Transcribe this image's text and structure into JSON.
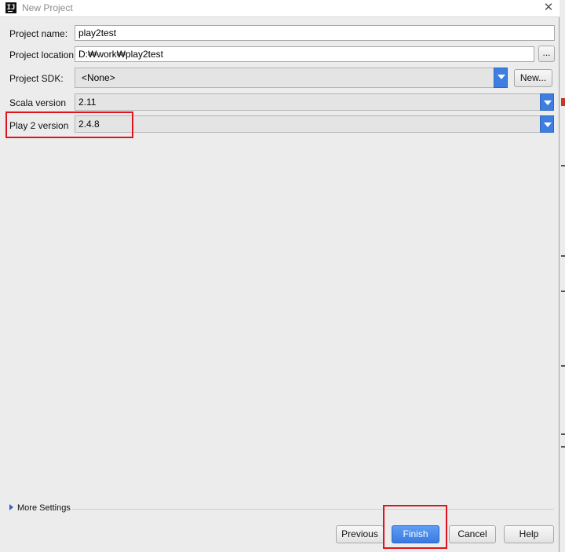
{
  "window": {
    "title": "New Project",
    "app_icon": "IJ"
  },
  "form": {
    "project_name": {
      "label": "Project name:",
      "value": "play2test"
    },
    "project_location": {
      "label": "Project location:",
      "value": "D:₩work₩play2test",
      "browse_label": "..."
    },
    "project_sdk": {
      "label": "Project SDK:",
      "value": "<None>",
      "new_label": "New..."
    },
    "scala_version": {
      "label": "Scala version",
      "value": "2.11"
    },
    "play2_version": {
      "label": "Play 2 version",
      "value": "2.4.8"
    }
  },
  "more_settings": {
    "label": "More Settings"
  },
  "buttons": {
    "previous": "Previous",
    "finish": "Finish",
    "cancel": "Cancel",
    "help": "Help"
  },
  "colors": {
    "accent": "#3d7ee0",
    "highlight": "#e0141e"
  }
}
